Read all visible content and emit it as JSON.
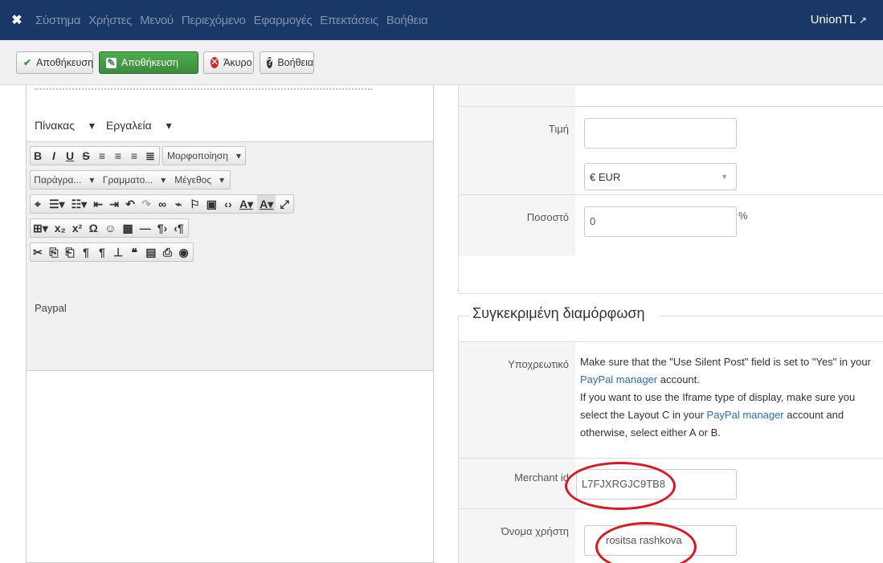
{
  "topnav": {
    "menu": [
      "Σύστημα",
      "Χρήστες",
      "Μενού",
      "Περιεχόμενο",
      "Εφαρμογές",
      "Επεκτάσεις",
      "Βοήθεια"
    ],
    "user": "UnionTL"
  },
  "toolbar": {
    "save_label": "Αποθήκευση",
    "save_close_label": "Αποθήκευση",
    "cancel_label": "Άκυρο",
    "help_label": "Βοήθεια"
  },
  "editor": {
    "menus": [
      "Πίνακας",
      "Εργαλεία"
    ],
    "format_dropdown": "Μορφοποίηση",
    "paragraph_dropdown": "Παράγρα...",
    "font_dropdown": "Γραμματο...",
    "size_dropdown": "Μέγεθος",
    "content": "Paypal"
  },
  "form": {
    "price_label": "Τιμή",
    "price_value": "",
    "currency_value": "€ EUR",
    "percent_label": "Ποσοστό",
    "percent_value": "0",
    "percent_unit": "%"
  },
  "specific": {
    "title": "Συγκεκριμένη διαμόρφωση",
    "required_label": "Υποχρεωτικό",
    "note_part1": "Make sure that the \"Use Silent Post\" field is set to \"Yes\" in your ",
    "note_link1": "PayPal manager",
    "note_part2": " account.",
    "note_part3": "If you want to use the Iframe type of display, make sure you select the Layout C in your ",
    "note_link2": "PayPal manager",
    "note_part4": " account and otherwise, select either A or B.",
    "merchant_label": "Merchant id",
    "merchant_value": "L7FJXRGJC9TB8",
    "username_label": "Όνομα χρήστη",
    "username_value": "rositsa rashkova"
  },
  "colors": {
    "nav_bg": "#1a3867",
    "green": "#3d8b3d",
    "annotation_red": "#e0141e",
    "link": "#2a6dbf"
  }
}
